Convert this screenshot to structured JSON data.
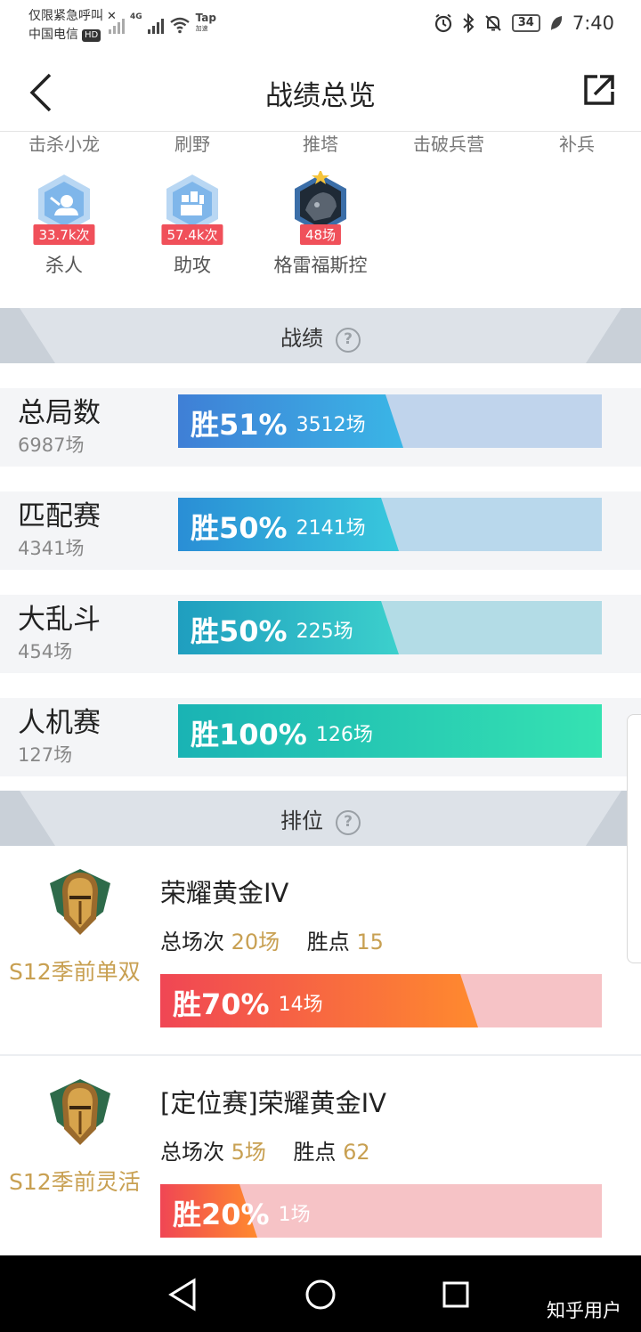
{
  "status_bar": {
    "emergency_text": "仅限紧急呼叫",
    "carrier": "中国电信",
    "hd": "HD",
    "network": "4G",
    "tap_label": "Tap",
    "tap_sub": "加速",
    "battery": "34",
    "time": "7:40"
  },
  "header": {
    "title": "战绩总览"
  },
  "honors": {
    "top_row": [
      "击杀小龙",
      "刷野",
      "推塔",
      "击破兵营",
      "补兵"
    ],
    "items": [
      {
        "label": "杀人",
        "count": "33.7k次",
        "icon": "kill-icon"
      },
      {
        "label": "助攻",
        "count": "57.4k次",
        "icon": "assist-icon"
      },
      {
        "label": "格雷福斯控",
        "count": "48场",
        "icon": "champion-avatar"
      }
    ]
  },
  "record_section": {
    "title": "战绩",
    "rows": [
      {
        "name": "总局数",
        "games": "6987场",
        "win_rate_label": "胜51%",
        "wins": "3512场",
        "win_fraction": 0.51
      },
      {
        "name": "匹配赛",
        "games": "4341场",
        "win_rate_label": "胜50%",
        "wins": "2141场",
        "win_fraction": 0.5
      },
      {
        "name": "大乱斗",
        "games": "454场",
        "win_rate_label": "胜50%",
        "wins": "225场",
        "win_fraction": 0.5
      },
      {
        "name": "人机赛",
        "games": "127场",
        "win_rate_label": "胜100%",
        "wins": "126场",
        "win_fraction": 1.0
      }
    ]
  },
  "ranked_section": {
    "title": "排位",
    "cards": [
      {
        "season": "S12季前单双",
        "rank": "荣耀黄金IV",
        "total_label": "总场次",
        "total": "20场",
        "points_label": "胜点",
        "points": "15",
        "win_rate_label": "胜70%",
        "wins": "14场",
        "win_fraction": 0.7
      },
      {
        "season": "S12季前灵活",
        "rank": "[定位赛]荣耀黄金IV",
        "total_label": "总场次",
        "total": "5场",
        "points_label": "胜点",
        "points": "62",
        "win_rate_label": "胜20%",
        "wins": "1场",
        "win_fraction": 0.2
      }
    ]
  },
  "watermark": "知乎用户",
  "colors": {
    "accent_gold": "#c8a052",
    "rank_bar_track": "#f6c3c6",
    "section_bg": "#dde2e8"
  }
}
